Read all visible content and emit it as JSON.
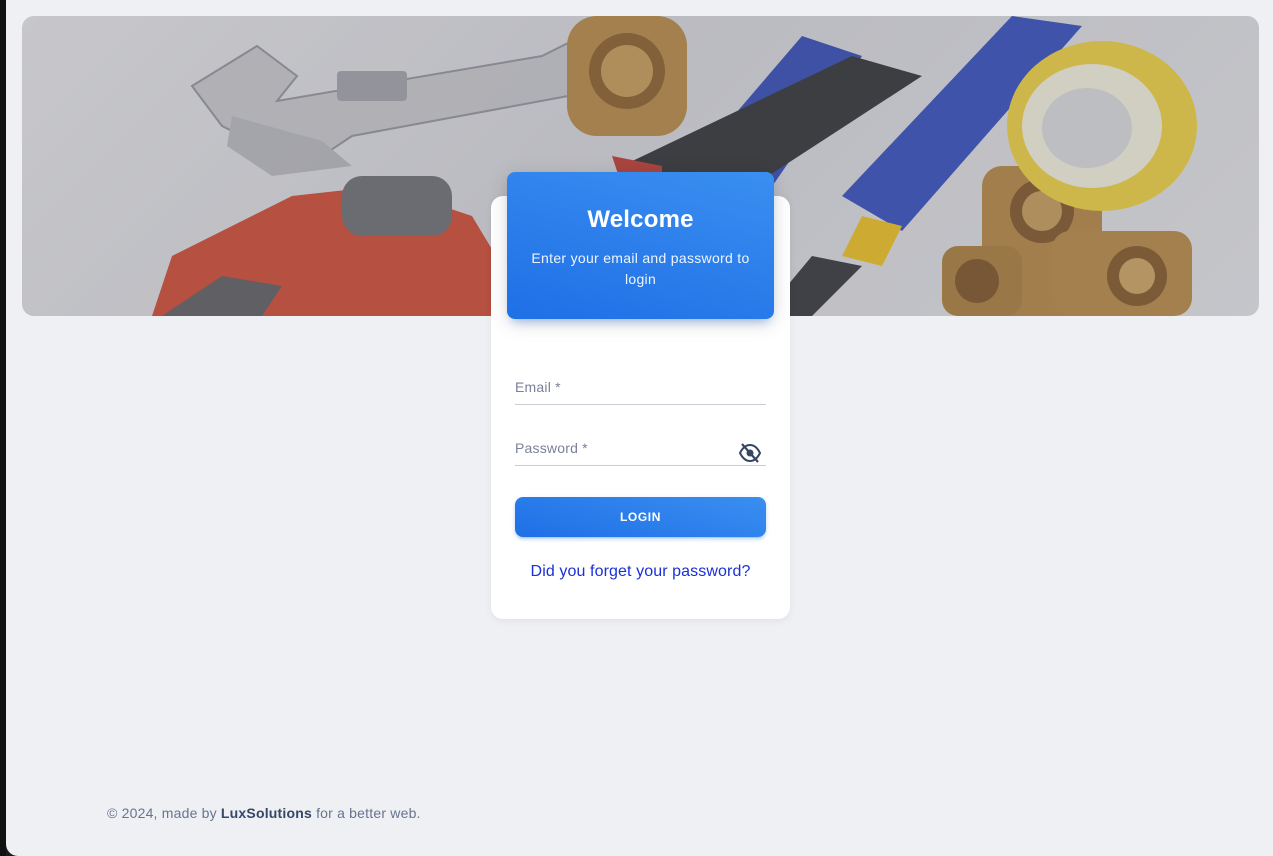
{
  "hero": {
    "image": "plumbing-tools-photo"
  },
  "card": {
    "title": "Welcome",
    "subtitle": "Enter your email and password to login"
  },
  "form": {
    "email_label": "Email *",
    "password_label": "Password *",
    "login_label": "LOGIN",
    "forgot_label": "Did you forget your password?",
    "password_toggle_icon": "visibility-off-icon"
  },
  "footer": {
    "prefix": "© 2024, made by",
    "brand": "LuxSolutions",
    "suffix": "for a better web."
  },
  "colors": {
    "primary": "#1f6fe6",
    "link": "#1a2fd6",
    "background": "#eef0f4"
  }
}
